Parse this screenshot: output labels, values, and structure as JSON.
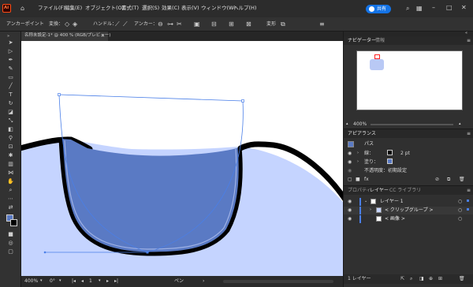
{
  "app": {
    "logo_text": "Ai",
    "menus": [
      "ファイル(F)",
      "編集(E)",
      "オブジェクト(O)",
      "書式(T)",
      "選択(S)",
      "効果(C)",
      "表示(V)",
      "ウィンドウ(W)",
      "ヘルプ(H)"
    ],
    "share_label": "共有",
    "colors": {
      "accent": "#1473e6",
      "app_bg": "#323232",
      "artboard": "#ffffff",
      "fill_light": "#c5d4ff",
      "fill_dark": "#5a7ac4",
      "logo_bg": "#ff4c15",
      "logo_fg": "#330000",
      "selection": "#4a7fe8"
    }
  },
  "control_bar": {
    "mode_label": "アンカーポイント",
    "convert_label": "変換：",
    "handle_label": "ハンドル：",
    "anchor_label": "アンカー：",
    "transform_label": "変形"
  },
  "document": {
    "tab_title": "名称未設定-1* @ 400 % (RGB/プレビュー)"
  },
  "status_bar": {
    "zoom": "400%",
    "angle": "0°",
    "page": "1",
    "tool_name": "ペン"
  },
  "navigator": {
    "tabs": [
      "ナビゲーター",
      "情報"
    ],
    "zoom": "400%"
  },
  "appearance": {
    "title": "アピアランス",
    "object_name": "パス",
    "stroke_label": "線：",
    "stroke_weight": "2 pt",
    "fill_label": "塗り：",
    "opacity_label": "不透明度：",
    "opacity_value": "初期設定"
  },
  "layers": {
    "tabs": [
      "プロパティ",
      "レイヤー",
      "CC ライブラリ"
    ],
    "rows": [
      {
        "name": "レイヤー 1"
      },
      {
        "name": "< クリップグループ >"
      },
      {
        "name": "< 画像 >"
      }
    ],
    "footer": "1 レイヤー"
  }
}
